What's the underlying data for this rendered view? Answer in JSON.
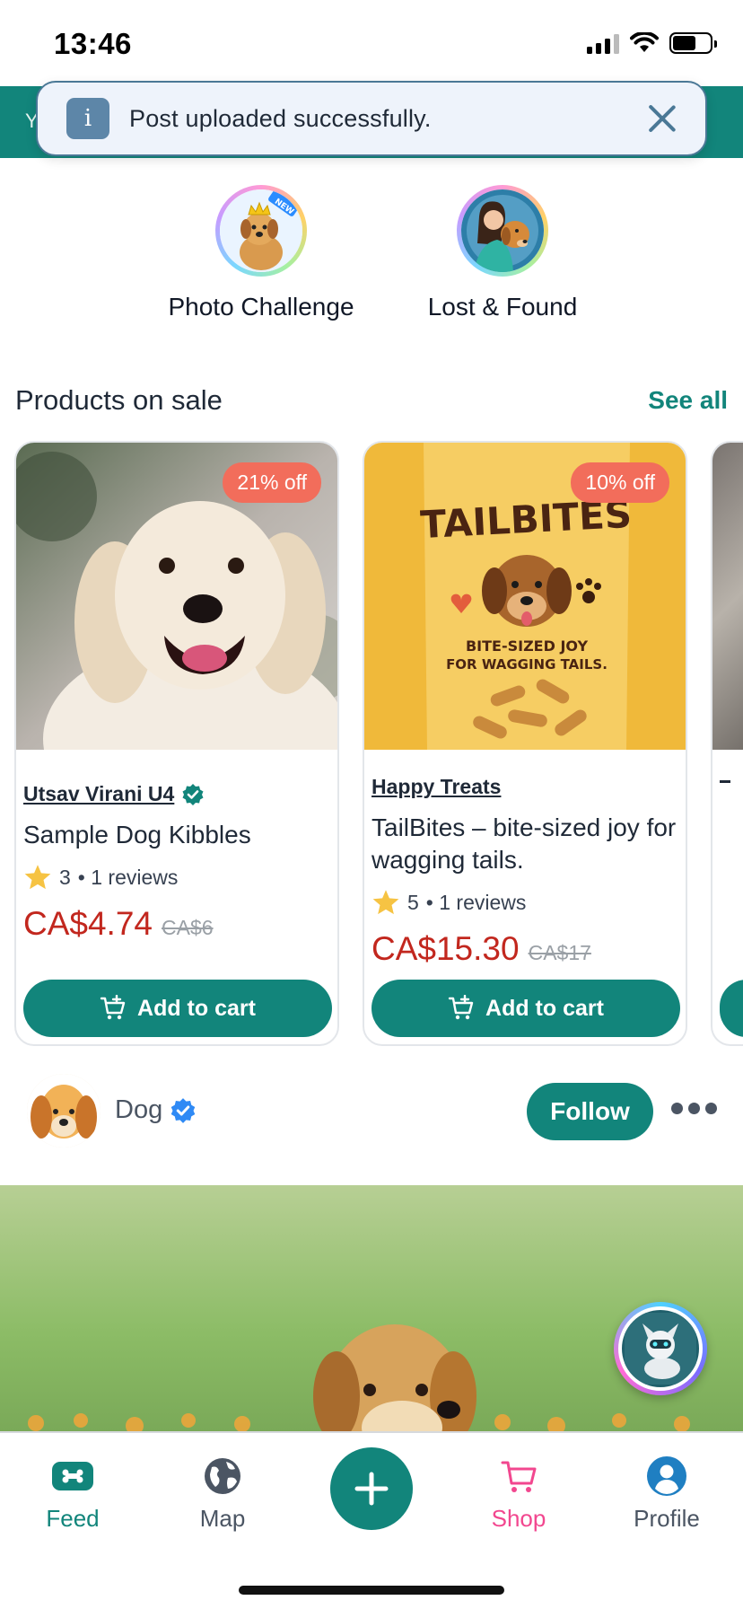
{
  "status_bar": {
    "time": "13:46"
  },
  "teal_strip": {
    "partial_text": "Y"
  },
  "toast": {
    "icon": "i",
    "message": "Post uploaded successfully."
  },
  "features": [
    {
      "label": "Photo Challenge",
      "icon": "dog-king-icon",
      "tag": "NEW"
    },
    {
      "label": "Lost & Found",
      "icon": "woman-hugging-dog-icon"
    }
  ],
  "products_section": {
    "title": "Products on sale",
    "see_all": "See all"
  },
  "products": [
    {
      "badge": "21% off",
      "seller": "Utsav Virani U4",
      "seller_verified": true,
      "name": "Sample Dog Kibbles",
      "rating": "3",
      "reviews": "• 1 reviews",
      "price": "CA$4.74",
      "old_price": "CA$6",
      "cart_label": "Add to cart"
    },
    {
      "badge": "10% off",
      "seller": "Happy Treats",
      "seller_verified": false,
      "name": "TailBites – bite-sized joy for wagging tails.",
      "rating": "5",
      "reviews": "• 1 reviews",
      "price": "CA$15.30",
      "old_price": "CA$17",
      "cart_label": "Add to cart",
      "package_text": {
        "brand": "TAILBITES",
        "line1": "BITE-SIZED JOY",
        "line2": "FOR WAGGING TAILS."
      }
    }
  ],
  "post": {
    "user": "Dog",
    "verified": true,
    "follow_label": "Follow"
  },
  "bottom_nav": [
    {
      "label": "Feed",
      "icon": "bone-icon"
    },
    {
      "label": "Map",
      "icon": "globe-icon"
    },
    {
      "label": "Shop",
      "icon": "cart-icon"
    },
    {
      "label": "Profile",
      "icon": "person-icon"
    }
  ],
  "colors": {
    "brand": "#12857b",
    "price": "#c2271e",
    "shop_accent": "#f2478f",
    "badge": "#f26d5b"
  }
}
